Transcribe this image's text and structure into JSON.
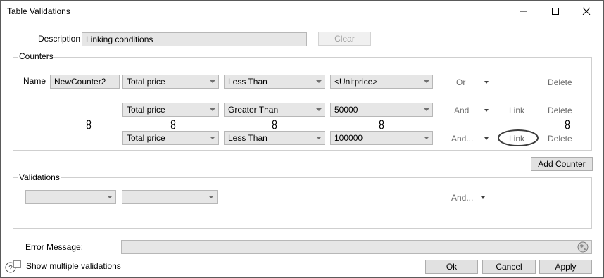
{
  "window": {
    "title": "Table Validations"
  },
  "description": {
    "label": "Description",
    "value": "Linking conditions",
    "clear_label": "Clear"
  },
  "counters": {
    "legend": "Counters",
    "name_label": "Name",
    "name_value": "NewCounter2",
    "rows": [
      {
        "field": "Total price",
        "operator": "Less Than",
        "value": "<Unitprice>",
        "conjunction": "Or",
        "link": "",
        "delete": "Delete"
      },
      {
        "field": "Total price",
        "operator": "Greater Than",
        "value": "50000",
        "conjunction": "And",
        "link": "Link",
        "delete": "Delete"
      },
      {
        "field": "Total price",
        "operator": "Less Than",
        "value": "100000",
        "conjunction": "And...",
        "link": "Link",
        "delete": "Delete"
      }
    ],
    "add_label": "Add Counter"
  },
  "validations": {
    "legend": "Validations",
    "conjunction": "And..."
  },
  "error": {
    "label": "Error Message:"
  },
  "footer": {
    "show_multiple": "Show multiple validations",
    "ok": "Ok",
    "cancel": "Cancel",
    "apply": "Apply"
  }
}
